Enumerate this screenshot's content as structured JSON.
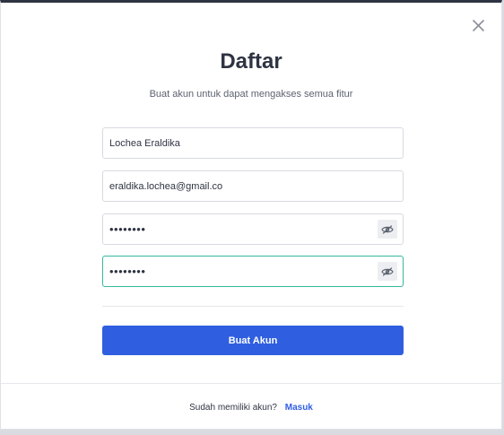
{
  "modal": {
    "title": "Daftar",
    "subtitle": "Buat akun untuk dapat mengakses semua fitur"
  },
  "form": {
    "name_value": "Lochea Eraldika",
    "email_value": "eraldika.lochea@gmail.co",
    "password_value": "••••••••",
    "confirm_password_value": "••••••••",
    "submit_label": "Buat Akun"
  },
  "footer": {
    "prompt": "Sudah memiliki akun?",
    "login_link": "Masuk"
  },
  "icons": {
    "close": "close-icon",
    "eye": "eye-slash-icon"
  },
  "colors": {
    "primary": "#2f5fe0",
    "focus_border": "#35b7a0",
    "title": "#2f3442"
  }
}
